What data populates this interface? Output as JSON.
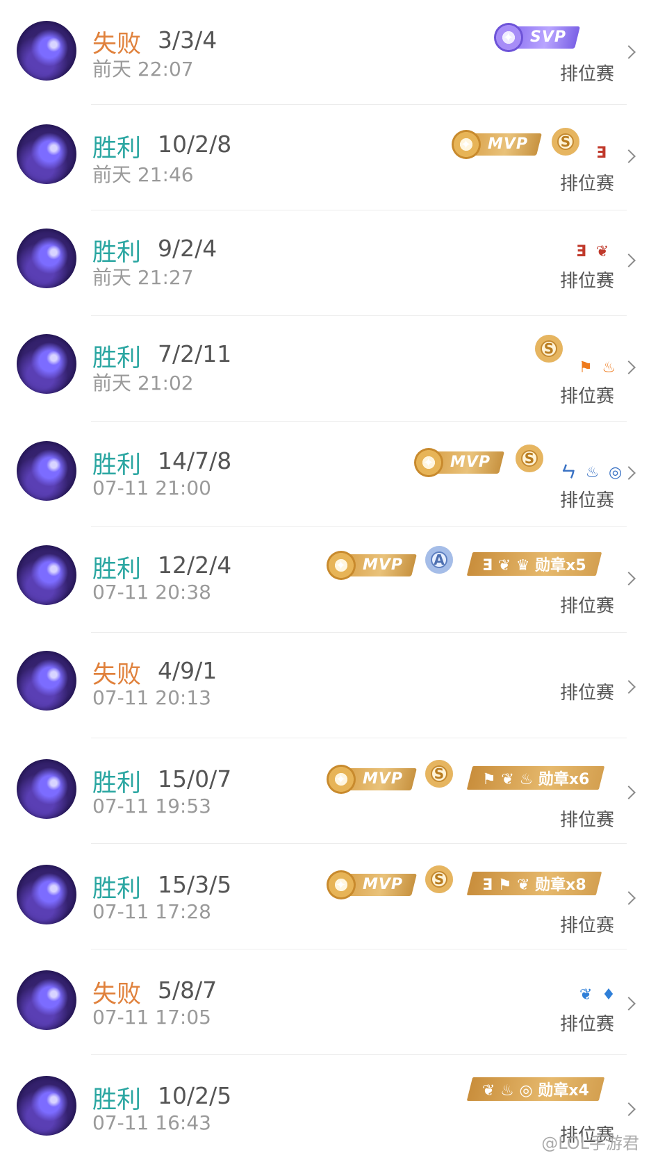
{
  "mode_label": "排位赛",
  "watermark": "@LOL手游君",
  "matches": [
    {
      "result": "失败",
      "kda": "3/3/4",
      "time": "前天 22:07"
    },
    {
      "result": "胜利",
      "kda": "10/2/8",
      "time": "前天 21:46"
    },
    {
      "result": "胜利",
      "kda": "9/2/4",
      "time": "前天 21:27"
    },
    {
      "result": "胜利",
      "kda": "7/2/11",
      "time": "前天 21:02"
    },
    {
      "result": "胜利",
      "kda": "14/7/8",
      "time": "07-11 21:00"
    },
    {
      "result": "胜利",
      "kda": "12/2/4",
      "time": "07-11 20:38"
    },
    {
      "result": "失败",
      "kda": "4/9/1",
      "time": "07-11 20:13"
    },
    {
      "result": "胜利",
      "kda": "15/0/7",
      "time": "07-11 19:53"
    },
    {
      "result": "胜利",
      "kda": "15/3/5",
      "time": "07-11 17:28"
    },
    {
      "result": "失败",
      "kda": "5/8/7",
      "time": "07-11 17:05"
    },
    {
      "result": "胜利",
      "kda": "10/2/5",
      "time": "07-11 16:43"
    }
  ],
  "badges": {
    "svp": "SVP",
    "mvp": "MVP",
    "grade_s": "S",
    "grade_a": "A",
    "row2_icons": "Ǝ",
    "row3_icons": "Ǝ ❦",
    "row4_icons": "⚑ ♨",
    "row5_icons": "ㄣ ♨ ◎",
    "row6_plate": "Ǝ ❦ ♛ 勋章x5",
    "row8_plate": "⚑ ❦ ♨ 勋章x6",
    "row9_plate": "Ǝ ⚑ ❦ 勋章x8",
    "row10_icons": "❦ ♦",
    "row11_plate": "❦ ♨ ◎ 勋章x4"
  }
}
